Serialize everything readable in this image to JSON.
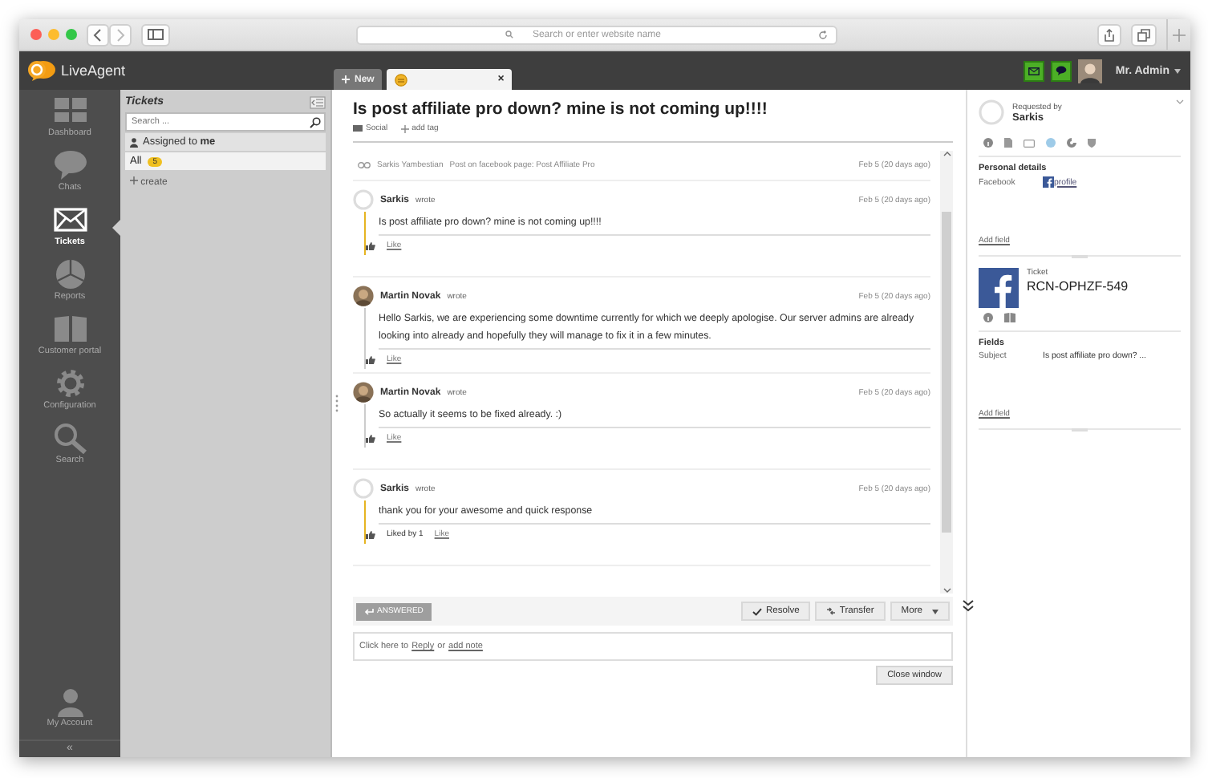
{
  "browser": {
    "address_placeholder": "Search or enter website name"
  },
  "app": {
    "logo": "LiveAgent",
    "user": "Mr. Admin"
  },
  "nav": [
    {
      "label": "Dashboard",
      "kind": "dashboard",
      "selected": false
    },
    {
      "label": "Chats",
      "kind": "chats",
      "selected": false
    },
    {
      "label": "Tickets",
      "kind": "tickets",
      "selected": true
    },
    {
      "label": "Reports",
      "kind": "reports",
      "selected": false
    },
    {
      "label": "Customer portal",
      "kind": "portal",
      "selected": false
    },
    {
      "label": "Configuration",
      "kind": "configuration",
      "selected": false
    },
    {
      "label": "Search",
      "kind": "search",
      "selected": false
    }
  ],
  "nav_bottom": {
    "label": "My Account",
    "collapse": "«"
  },
  "tickets_panel": {
    "title": "Tickets",
    "search_placeholder": "Search ...",
    "group": "Assigned to **me**",
    "filters": [
      {
        "label": "All",
        "count": "5",
        "selected": true
      }
    ],
    "create": "create"
  },
  "tabs": [
    {
      "kind": "new",
      "label": "New",
      "selected": false
    },
    {
      "kind": "ticket",
      "close": "×",
      "selected": true
    }
  ],
  "ticket": {
    "title": "Is post affiliate pro down? mine is not coming up!!!!",
    "tag": "Social",
    "add_tag": "add tag",
    "source": {
      "author": "Sarkis Yambestian",
      "text": "Post on facebook page: Post Affiliate Pro",
      "date": "Feb 5 (20 days ago)"
    },
    "messages": [
      {
        "kind": "customer",
        "author": "Sarkis",
        "verb": "wrote",
        "date": "Feb 5 (20 days ago)",
        "body": "Is post affiliate pro down? mine is not coming up!!!!",
        "like": "Like"
      },
      {
        "kind": "agent",
        "author": "Martin Novak",
        "verb": "wrote",
        "date": "Feb 5 (20 days ago)",
        "body": "Hello Sarkis, we are experiencing some downtime currently for which we deeply apologise. Our server admins are already looking into already and hopefully they will manage to fix it in a few minutes.",
        "like": "Like"
      },
      {
        "kind": "agent",
        "author": "Martin Novak",
        "verb": "wrote",
        "date": "Feb 5 (20 days ago)",
        "body": "So actually it seems to be fixed already. :)",
        "like": "Like"
      },
      {
        "kind": "customer",
        "author": "Sarkis",
        "verb": "wrote",
        "date": "Feb 5 (20 days ago)",
        "body": "thank you for your awesome and quick response",
        "liked_by": "Liked by 1",
        "like": "Like"
      }
    ],
    "status": {
      "label": "ANSWERED",
      "disabled": true
    },
    "actions": [
      {
        "kind": "resolve",
        "label": "Resolve"
      },
      {
        "kind": "transfer",
        "label": "Transfer"
      },
      {
        "kind": "more",
        "label": "More"
      }
    ],
    "reply": {
      "prefix": "Click here to",
      "reply_link": "Reply",
      "or": "or",
      "note_link": "add note"
    },
    "close_button": "Close window"
  },
  "requester": {
    "caption": "Requested by",
    "name": "Sarkis",
    "section": "Personal details",
    "fields": [
      {
        "kind": "facebook",
        "label": "Facebook",
        "value": "profile"
      }
    ],
    "add_field": "Add field"
  },
  "ticket_info": {
    "caption": "Ticket",
    "code": "RCN-OPHZF-549",
    "section": "Fields",
    "fields": [
      {
        "label": "Subject",
        "value": "Is post affiliate pro down? ..."
      }
    ],
    "add_field": "Add field"
  }
}
